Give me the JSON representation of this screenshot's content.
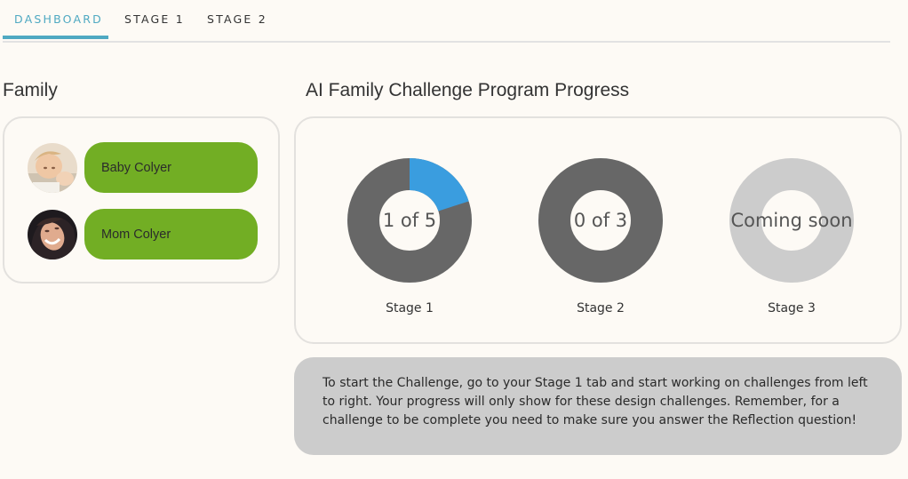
{
  "tabs": [
    {
      "label": "DASHBOARD",
      "active": true
    },
    {
      "label": "STAGE 1",
      "active": false
    },
    {
      "label": "STAGE 2",
      "active": false
    }
  ],
  "family": {
    "title": "Family",
    "members": [
      {
        "name": "Baby Colyer",
        "avatar_icon": "baby-photo"
      },
      {
        "name": "Mom Colyer",
        "avatar_icon": "mom-photo"
      }
    ]
  },
  "progress": {
    "title": "AI Family Challenge Program Progress",
    "stages": [
      {
        "label": "Stage 1",
        "center_text": "1 of 5",
        "completed": 1,
        "total": 5,
        "available": true
      },
      {
        "label": "Stage 2",
        "center_text": "0 of 3",
        "completed": 0,
        "total": 3,
        "available": true
      },
      {
        "label": "Stage 3",
        "center_text": "Coming soon",
        "completed": 0,
        "total": 0,
        "available": false
      }
    ]
  },
  "info": {
    "text": "To start the Challenge, go to your Stage 1 tab and start working on challenges from left to right. Your progress will only show for these design challenges. Remember, for a challenge to be complete you need to make sure you answer the Reflection question!"
  },
  "colors": {
    "accent": "#4fa9c2",
    "member_pill": "#72ae24",
    "donut_progress": "#3a9ddf",
    "donut_track": "#676767",
    "donut_unavailable": "#cccccc",
    "info_bg": "#cccccc"
  }
}
